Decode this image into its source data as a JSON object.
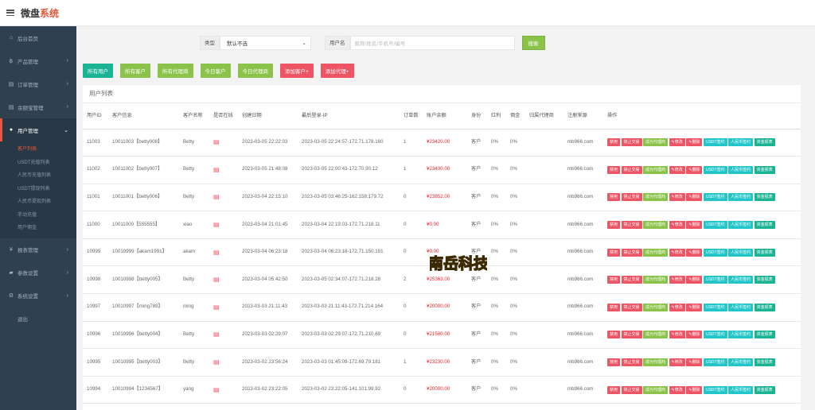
{
  "app": {
    "title_main": "微盘",
    "title_accent": "系统"
  },
  "sidebar": {
    "items": [
      {
        "icon": "home-icon",
        "glyph": "⌂",
        "label": "后台首页",
        "chev": ""
      },
      {
        "icon": "currency-icon",
        "glyph": "฿",
        "label": "产品管理",
        "chev": "›"
      },
      {
        "icon": "file-icon",
        "glyph": "▤",
        "label": "订单管理",
        "chev": "›"
      },
      {
        "icon": "file-icon",
        "glyph": "▤",
        "label": "余额宝管理",
        "chev": "›"
      },
      {
        "icon": "user-icon",
        "glyph": "●",
        "label": "用户管理",
        "chev": "⌄"
      }
    ],
    "sub_items": [
      "客户列表",
      "USDT充值列表",
      "人民币充值列表",
      "USDT提现列表",
      "人民币提现列表",
      "手动充值",
      "用户佣金"
    ],
    "items_after": [
      {
        "icon": "yen-icon",
        "glyph": "¥",
        "label": "报表管理",
        "chev": "›"
      },
      {
        "icon": "chat-icon",
        "glyph": "▰",
        "label": "参数设置",
        "chev": "›"
      },
      {
        "icon": "gears-icon",
        "glyph": "⚙",
        "label": "系统设置",
        "chev": "›"
      },
      {
        "icon": "",
        "glyph": "",
        "label": "退出",
        "chev": ""
      }
    ]
  },
  "search": {
    "type_label": "类型",
    "type_value": "默认不选",
    "user_label": "用户名",
    "user_placeholder": "昵称/姓名/手机号/编号",
    "search_button": "搜索"
  },
  "filters": [
    {
      "label": "所有用户",
      "color": "teal"
    },
    {
      "label": "所有客户",
      "color": "green"
    },
    {
      "label": "所有代理商",
      "color": "green"
    },
    {
      "label": "今日客户",
      "color": "green"
    },
    {
      "label": "今日代理商",
      "color": "green"
    },
    {
      "label": "添加客户+",
      "color": "red"
    },
    {
      "label": "添加代理+",
      "color": "red"
    }
  ],
  "table": {
    "title": "用户列表",
    "headers": [
      "用户ID",
      "客户信息",
      "客户名称",
      "是否在线",
      "创建日期",
      "最后登录-IP",
      "订单数",
      "账户余额",
      "身份",
      "红利",
      "佣金",
      "归属代理商",
      "注册来源",
      "操作"
    ],
    "rows": [
      {
        "id": "11003",
        "info": "10011003【betty008】",
        "name": "Betty",
        "online": "▤",
        "created": "2023-03-05 22:22:03",
        "login": "2023-03-05 22:24:57-172.71.178.160",
        "orders": "1",
        "balance": "¥23420.00",
        "role": "客户",
        "bonus": "0%",
        "commission": "0%",
        "agent": "",
        "source": "mb966.com"
      },
      {
        "id": "11002",
        "info": "10011002【betty007】",
        "name": "Betty",
        "online": "▤",
        "created": "2023-03-05 21:48:08",
        "login": "2023-03-05 22:00:43-172.70.90.12",
        "orders": "1",
        "balance": "¥23430.00",
        "role": "客户",
        "bonus": "0%",
        "commission": "0%",
        "agent": "",
        "source": "mb966.com"
      },
      {
        "id": "11001",
        "info": "10011001【betty006】",
        "name": "Betty",
        "online": "▤",
        "created": "2023-03-04 22:15:10",
        "login": "2023-03-05 03:46:25-162.158.179.72",
        "orders": "0",
        "balance": "¥23852.00",
        "role": "客户",
        "bonus": "0%",
        "commission": "0%",
        "agent": "",
        "source": "mb966.com"
      },
      {
        "id": "11000",
        "info": "10011000【555555】",
        "name": "xiao",
        "online": "▤",
        "created": "2023-03-04 21:01:45",
        "login": "2023-03-04 22:19:03-172.71.218.11",
        "orders": "0",
        "balance": "¥0.00",
        "role": "客户",
        "bonus": "0%",
        "commission": "0%",
        "agent": "",
        "source": "mb966.com"
      },
      {
        "id": "10999",
        "info": "10010999【akam1991】",
        "name": "akam",
        "online": "▤",
        "created": "2023-03-04 06:23:18",
        "login": "2023-03-04 06:23:18-172.71.150.191",
        "orders": "0",
        "balance": "¥0.00",
        "role": "客户",
        "bonus": "0%",
        "commission": "0%",
        "agent": "",
        "source": "mb966.com"
      },
      {
        "id": "10998",
        "info": "10010998【betty005】",
        "name": "Betty",
        "online": "▤",
        "created": "2023-03-04 05:42:50",
        "login": "2023-03-05 02:34:07-172.71.218.28",
        "orders": "2",
        "balance": "¥25363.00",
        "role": "客户",
        "bonus": "0%",
        "commission": "0%",
        "agent": "",
        "source": "mb966.com"
      },
      {
        "id": "10997",
        "info": "10010997【ming789】",
        "name": "ming",
        "online": "▤",
        "created": "2023-03-03 21:11:43",
        "login": "2023-03-03 21:11:43-172.71.214.164",
        "orders": "0",
        "balance": "¥20000.00",
        "role": "客户",
        "bonus": "0%",
        "commission": "0%",
        "agent": "",
        "source": "mb966.com"
      },
      {
        "id": "10996",
        "info": "10010996【betty004】",
        "name": "Betty",
        "online": "▤",
        "created": "2023-03-03 02:29:07",
        "login": "2023-03-03 02:29:07-172.71.210.69",
        "orders": "0",
        "balance": "¥21580.00",
        "role": "客户",
        "bonus": "0%",
        "commission": "0%",
        "agent": "",
        "source": "mb966.com"
      },
      {
        "id": "10995",
        "info": "10010995【betty003】",
        "name": "Betty",
        "online": "▤",
        "created": "2023-03-02 23:56:24",
        "login": "2023-03-03 01:45:09-172.69.79.181",
        "orders": "1",
        "balance": "¥23230.00",
        "role": "客户",
        "bonus": "0%",
        "commission": "0%",
        "agent": "",
        "source": "mb966.com"
      },
      {
        "id": "10994",
        "info": "10010994【1234567】",
        "name": "yang",
        "online": "▤",
        "created": "2023-03-02 23:22:05",
        "login": "2023-03-02 23:22:05-141.101.99.92",
        "orders": "0",
        "balance": "¥20000.00",
        "role": "客户",
        "bonus": "0%",
        "commission": "0%",
        "agent": "",
        "source": "mb966.com"
      }
    ],
    "actions": [
      {
        "label": "禁用",
        "color": "red"
      },
      {
        "label": "禁止交易",
        "color": "red"
      },
      {
        "label": "成为代理商",
        "color": "green"
      },
      {
        "label": "✎修改",
        "color": "red"
      },
      {
        "label": "✎删除",
        "color": "red"
      },
      {
        "label": "USDT签约",
        "color": "blue"
      },
      {
        "label": "人民币签约",
        "color": "blue"
      },
      {
        "label": "资金报表",
        "color": "teal"
      }
    ]
  },
  "watermark": "南岳科技"
}
